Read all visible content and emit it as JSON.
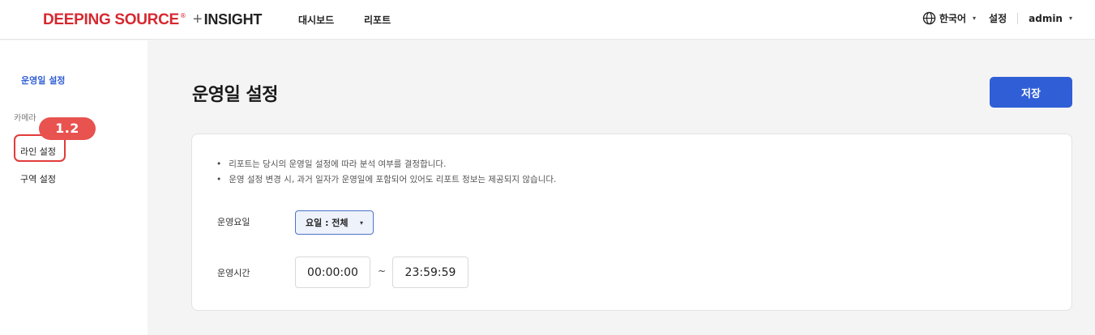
{
  "header": {
    "logo_brand": "DEEPING SOURCE",
    "logo_reg": "®",
    "logo_plus": "+",
    "logo_product": "INSIGHT",
    "nav": [
      "대시보드",
      "리포트"
    ],
    "language": "한국어",
    "settings": "설정",
    "user": "admin",
    "caret": "▾"
  },
  "sidebar": {
    "active_item": "운영일 설정",
    "section_title": "카메라",
    "items": [
      "라인 설정",
      "구역 설정"
    ]
  },
  "badge": {
    "label": "1.2"
  },
  "main": {
    "title": "운영일 설정",
    "save_label": "저장",
    "notes": [
      "리포트는 당시의 운영일 설정에 따라 분석 여부를 결정합니다.",
      "운영 설정 변경 시, 과거 일자가 운영일에 포함되어 있어도 리포트 정보는 제공되지 않습니다."
    ],
    "days_label": "운영요일",
    "days_value": "요일 : 전체",
    "time_label": "운영시간",
    "time_start": "00:00:00",
    "time_separator": "~",
    "time_end": "23:59:59"
  },
  "colors": {
    "brand_red": "#d7282f",
    "accent_blue": "#2f5ed6",
    "badge_red": "#e8524f",
    "highlight_border": "#e23b3b"
  },
  "icons": {
    "globe": "globe-icon",
    "caret": "chevron-down-icon"
  }
}
